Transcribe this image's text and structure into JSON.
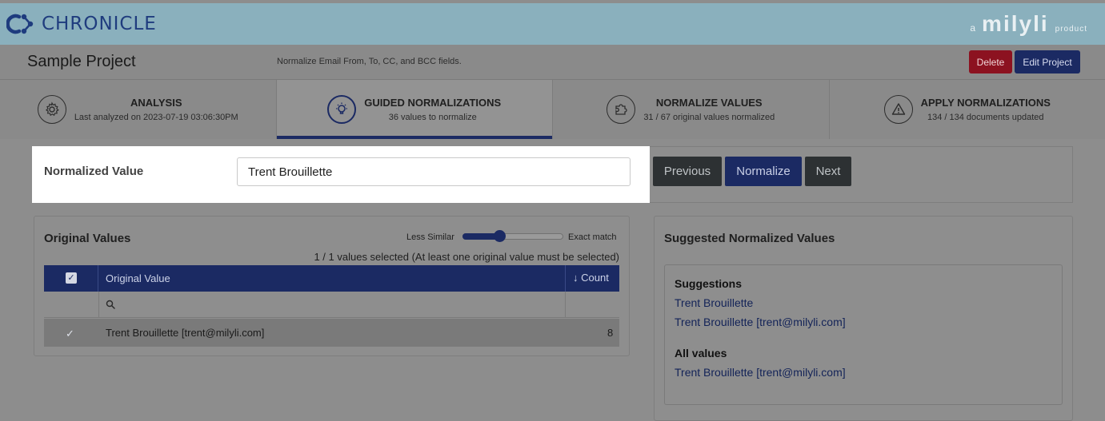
{
  "app": {
    "title": "CHRONICLE",
    "brand_prefix": "a",
    "brand_name": "milyli",
    "brand_suffix": "product"
  },
  "project": {
    "title": "Sample Project",
    "description": "Normalize Email From, To, CC, and BCC fields.",
    "delete_label": "Delete",
    "edit_label": "Edit Project"
  },
  "steps": [
    {
      "title": "ANALYSIS",
      "subtitle": "Last analyzed on 2023-07-19 03:06:30PM",
      "icon": "gear-icon"
    },
    {
      "title": "GUIDED NORMALIZATIONS",
      "subtitle": "36 values to normalize",
      "icon": "lightbulb-icon"
    },
    {
      "title": "NORMALIZE VALUES",
      "subtitle": "31 / 67 original values normalized",
      "icon": "puzzle-icon"
    },
    {
      "title": "APPLY NORMALIZATIONS",
      "subtitle": "134 / 134 documents updated",
      "icon": "warning-icon"
    }
  ],
  "normalized": {
    "label": "Normalized Value",
    "value": "Trent Brouillette",
    "previous_label": "Previous",
    "normalize_label": "Normalize",
    "next_label": "Next"
  },
  "original_values": {
    "title": "Original Values",
    "slider_less": "Less Similar",
    "slider_exact": "Exact match",
    "slider_level": 0.34,
    "selected_note": "1 / 1 values selected (At least one original value must be selected)",
    "column_value": "Original Value",
    "column_count": "↓ Count",
    "rows": [
      {
        "value": "Trent Brouillette [trent@milyli.com]",
        "count": "8"
      }
    ]
  },
  "suggested": {
    "title": "Suggested Normalized Values",
    "suggestions_heading": "Suggestions",
    "suggestions": [
      "Trent Brouillette",
      "Trent Brouillette [trent@milyli.com]"
    ],
    "all_heading": "All values",
    "all_values": [
      "Trent Brouillette [trent@milyli.com]"
    ]
  },
  "colors": {
    "accent": "#1b2a63",
    "danger": "#8c1220",
    "header": "#8ab0bd"
  }
}
